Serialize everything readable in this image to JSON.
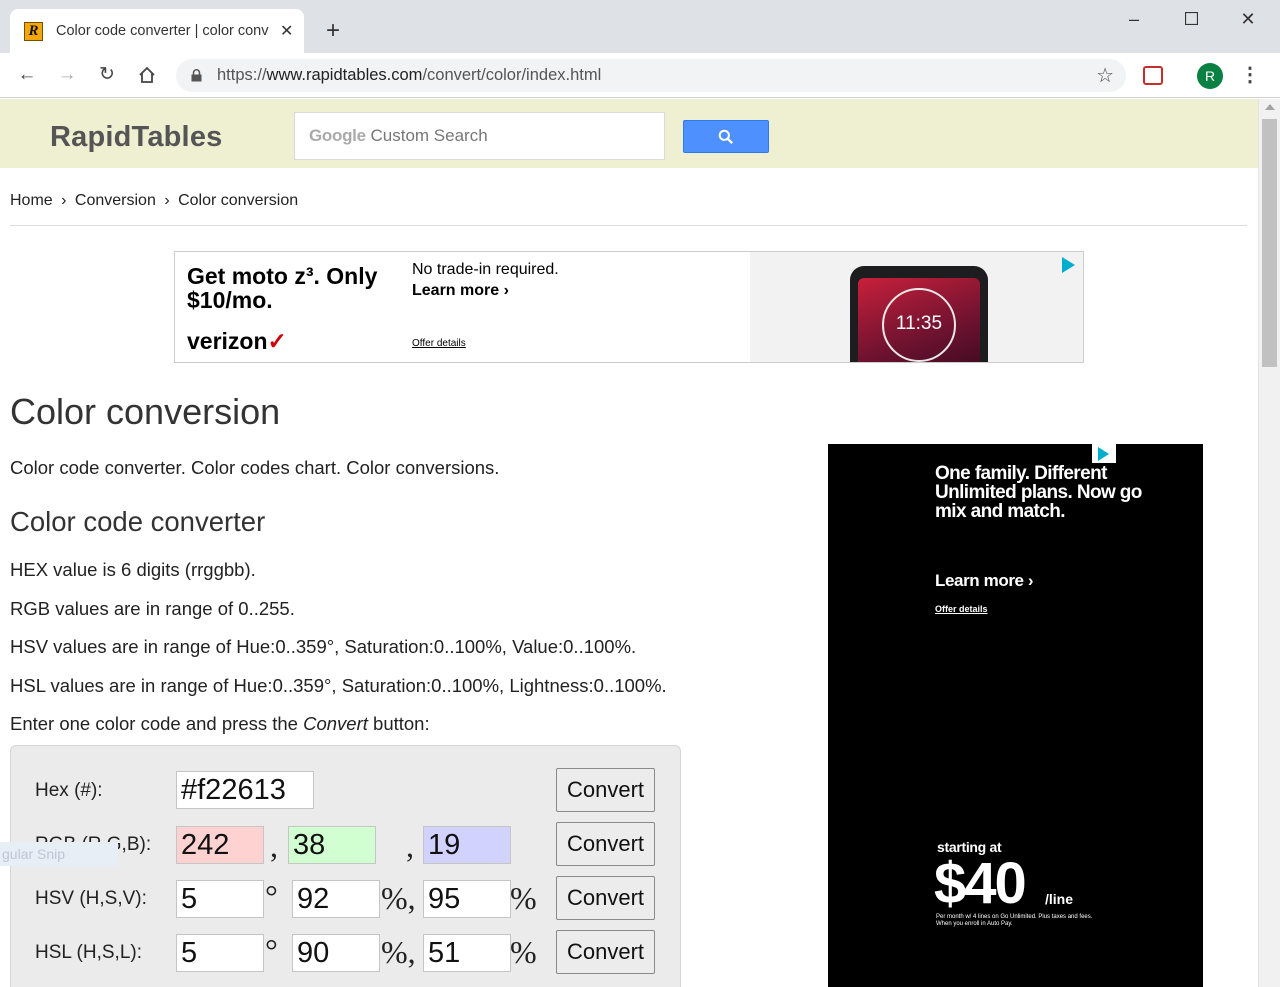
{
  "browser": {
    "tab_title": "Color code converter | color conv",
    "favicon_letter": "R",
    "new_tab_label": "+",
    "url_prefix": "https://",
    "url_host": "www.rapidtables.com",
    "url_path": "/convert/color/index.html",
    "avatar_letter": "R"
  },
  "site": {
    "logo": "RapidTables",
    "search_google": "Google",
    "search_placeholder": " Custom Search"
  },
  "breadcrumb": {
    "home": "Home",
    "sep": "›",
    "conversion": "Conversion",
    "current": "Color conversion"
  },
  "ad_top": {
    "headline": "Get moto z³. Only $10/mo.",
    "brand": "verizon",
    "brand_mark": "✓",
    "subtext": "No trade-in required.",
    "learn_more": "Learn more  ›",
    "offer": "Offer details",
    "clock": "11:35"
  },
  "content": {
    "title": "Color conversion",
    "intro": "Color code converter. Color codes chart. Color conversions.",
    "subtitle": "Color code converter",
    "hex_info": "HEX value is 6 digits (rrggbb).",
    "rgb_info": "RGB values are in range of 0..255.",
    "hsv_info": "HSV values are in range of Hue:0..359°, Saturation:0..100%, Value:0..100%.",
    "hsl_info": "HSL values are in range of Hue:0..359°, Saturation:0..100%, Lightness:0..100%.",
    "enter_prefix": "Enter one color code and press the ",
    "enter_em": "Convert",
    "enter_suffix": " button:"
  },
  "converter": {
    "hex": {
      "label": "Hex (#):",
      "value": "#f22613"
    },
    "rgb": {
      "label": "RGB (R,G,B):",
      "r": "242",
      "g": "38",
      "b": "19"
    },
    "hsv": {
      "label": "HSV (H,S,V):",
      "h": "5",
      "s": "92",
      "v": "95"
    },
    "hsl": {
      "label": "HSL (H,S,L):",
      "h": "5",
      "s": "90",
      "l": "51"
    },
    "comma": ",",
    "deg": "°",
    "pct_comma": "%,",
    "pct": "%",
    "button": "Convert",
    "colors": {
      "r_bg": "#ffd2d2",
      "g_bg": "#d2ffd2",
      "b_bg": "#d2d2ff"
    }
  },
  "ghost_text": "gular Snip",
  "ad_side": {
    "headline": "One family. Different Unlimited plans. Now go mix and match.",
    "learn_more": "Learn more  ›",
    "offer": "Offer details",
    "starting": "starting at",
    "price": "$40",
    "unit": "/line",
    "fine_print": "Per month w/ 4 lines on Go Unlimited. Plus taxes and fees. When you enroll in Auto Pay."
  }
}
